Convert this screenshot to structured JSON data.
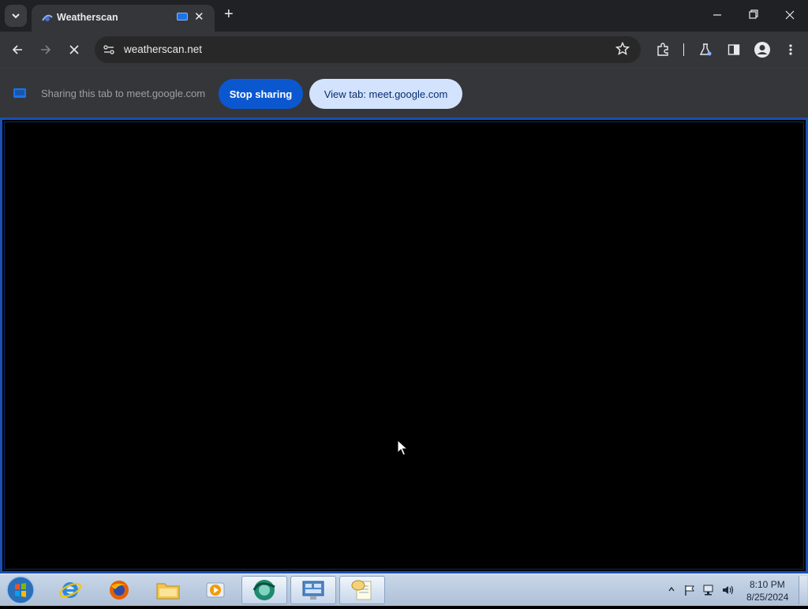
{
  "browser": {
    "tab": {
      "title": "Weatherscan"
    },
    "address_bar": {
      "url": "weatherscan.net"
    }
  },
  "infobar": {
    "message": "Sharing this tab to meet.google.com",
    "stop_label": "Stop sharing",
    "view_label": "View tab: meet.google.com"
  },
  "taskbar": {
    "apps": [
      {
        "name": "internet-explorer"
      },
      {
        "name": "firefox"
      },
      {
        "name": "file-explorer"
      },
      {
        "name": "media-player"
      },
      {
        "name": "chrome-like-app"
      },
      {
        "name": "control-panel"
      },
      {
        "name": "notepad"
      }
    ],
    "clock": {
      "time": "8:10 PM",
      "date": "8/25/2024"
    }
  },
  "colors": {
    "accent": "#1a73e8",
    "stop_button": "#0b57d0",
    "view_button": "#d3e3fd",
    "share_border": "#1a4fb3"
  }
}
